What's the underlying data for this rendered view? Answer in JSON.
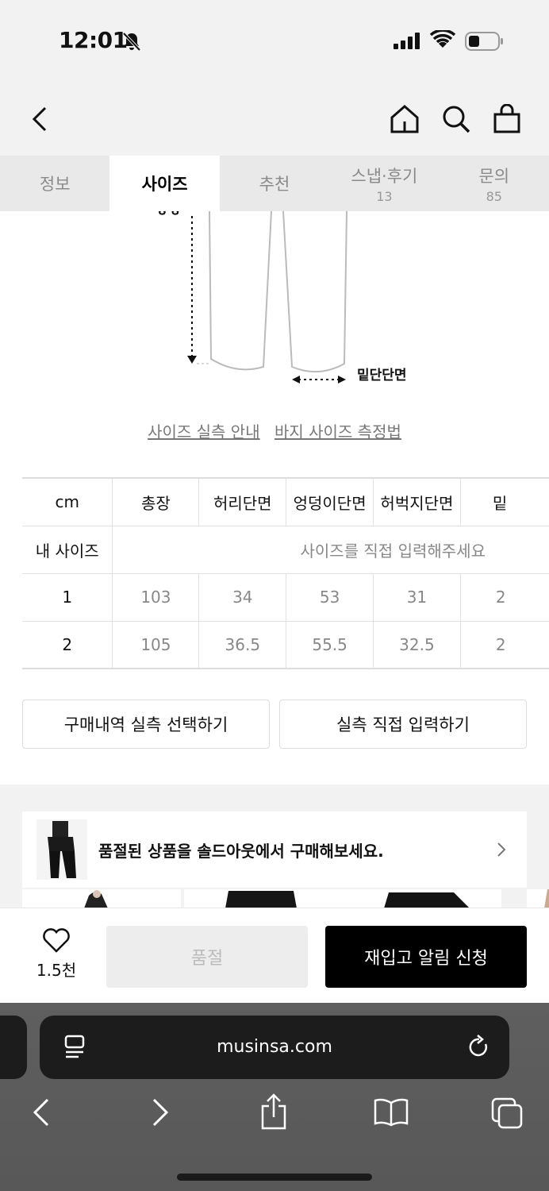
{
  "status": {
    "time": "12:01"
  },
  "tabs": [
    {
      "label": "정보",
      "count": ""
    },
    {
      "label": "사이즈",
      "count": ""
    },
    {
      "label": "추천",
      "count": ""
    },
    {
      "label": "스냅·후기",
      "count": "13"
    },
    {
      "label": "문의",
      "count": "85"
    }
  ],
  "diagram": {
    "hem_label": "밑단단면"
  },
  "links": {
    "size_guide": "사이즈 실측 안내",
    "measure_method": "바지 사이즈 측정법"
  },
  "size_table": {
    "headers": [
      "cm",
      "총장",
      "허리단면",
      "엉덩이단면",
      "허벅지단면",
      "밑"
    ],
    "my_size_label": "내 사이즈",
    "my_size_placeholder": "사이즈를 직접 입력해주세요",
    "rows": [
      {
        "size": "1",
        "values": [
          "103",
          "34",
          "53",
          "31",
          "2"
        ]
      },
      {
        "size": "2",
        "values": [
          "105",
          "36.5",
          "55.5",
          "32.5",
          "2"
        ]
      }
    ]
  },
  "buttons": {
    "history": "구매내역 실측 선택하기",
    "manual": "실측 직접 입력하기"
  },
  "banner": {
    "text": "품절된 상품을 솔드아웃에서 구매해보세요."
  },
  "bottom": {
    "like_count": "1.5천",
    "soldout": "품절",
    "restock": "재입고 알림 신청"
  },
  "browser": {
    "url": "musinsa.com"
  }
}
